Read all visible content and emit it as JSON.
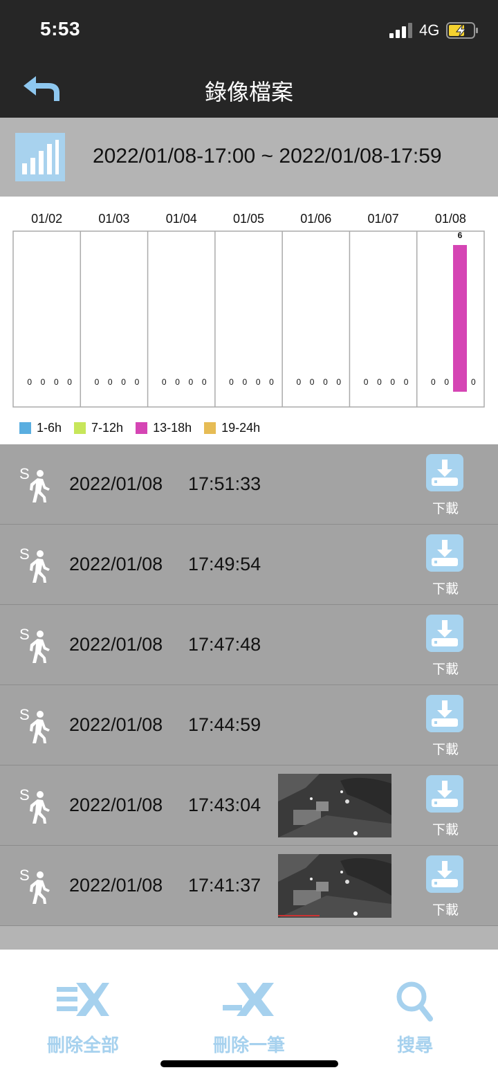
{
  "status": {
    "time": "5:53",
    "network": "4G"
  },
  "header": {
    "title": "錄像檔案"
  },
  "range": {
    "text": "2022/01/08-17:00 ~ 2022/01/08-17:59"
  },
  "colors": {
    "bar_1_6h": "#5aaee0",
    "bar_7_12h": "#c7e65a",
    "bar_13_18h": "#d545b4",
    "bar_19_24h": "#e6bc55",
    "accent": "#a6d1ee"
  },
  "chart_data": {
    "type": "bar",
    "categories": [
      "01/02",
      "01/03",
      "01/04",
      "01/05",
      "01/06",
      "01/07",
      "01/08"
    ],
    "series": [
      {
        "name": "1-6h",
        "values": [
          0,
          0,
          0,
          0,
          0,
          0,
          0
        ]
      },
      {
        "name": "7-12h",
        "values": [
          0,
          0,
          0,
          0,
          0,
          0,
          0
        ]
      },
      {
        "name": "13-18h",
        "values": [
          0,
          0,
          0,
          0,
          0,
          0,
          6
        ]
      },
      {
        "name": "19-24h",
        "values": [
          0,
          0,
          0,
          0,
          0,
          0,
          0
        ]
      }
    ],
    "ylim": [
      0,
      6
    ],
    "legend": "bottom-left",
    "grid": false
  },
  "records": [
    {
      "type_letter": "S",
      "type_icon": "person-walking-icon",
      "date": "2022/01/08",
      "time": "17:51:33",
      "thumbnail": false,
      "download_label": "下載"
    },
    {
      "type_letter": "S",
      "type_icon": "person-walking-icon",
      "date": "2022/01/08",
      "time": "17:49:54",
      "thumbnail": false,
      "download_label": "下載"
    },
    {
      "type_letter": "S",
      "type_icon": "person-walking-icon",
      "date": "2022/01/08",
      "time": "17:47:48",
      "thumbnail": false,
      "download_label": "下載"
    },
    {
      "type_letter": "S",
      "type_icon": "person-walking-icon",
      "date": "2022/01/08",
      "time": "17:44:59",
      "thumbnail": false,
      "download_label": "下載"
    },
    {
      "type_letter": "S",
      "type_icon": "person-walking-icon",
      "date": "2022/01/08",
      "time": "17:43:04",
      "thumbnail": true,
      "download_label": "下載"
    },
    {
      "type_letter": "S",
      "type_icon": "person-walking-icon",
      "date": "2022/01/08",
      "time": "17:41:37",
      "thumbnail": true,
      "download_label": "下載"
    }
  ],
  "bottom_tabs": [
    {
      "label": "刪除全部",
      "icon": "delete-all-icon"
    },
    {
      "label": "刪除一筆",
      "icon": "delete-one-icon"
    },
    {
      "label": "搜尋",
      "icon": "search-icon"
    }
  ]
}
